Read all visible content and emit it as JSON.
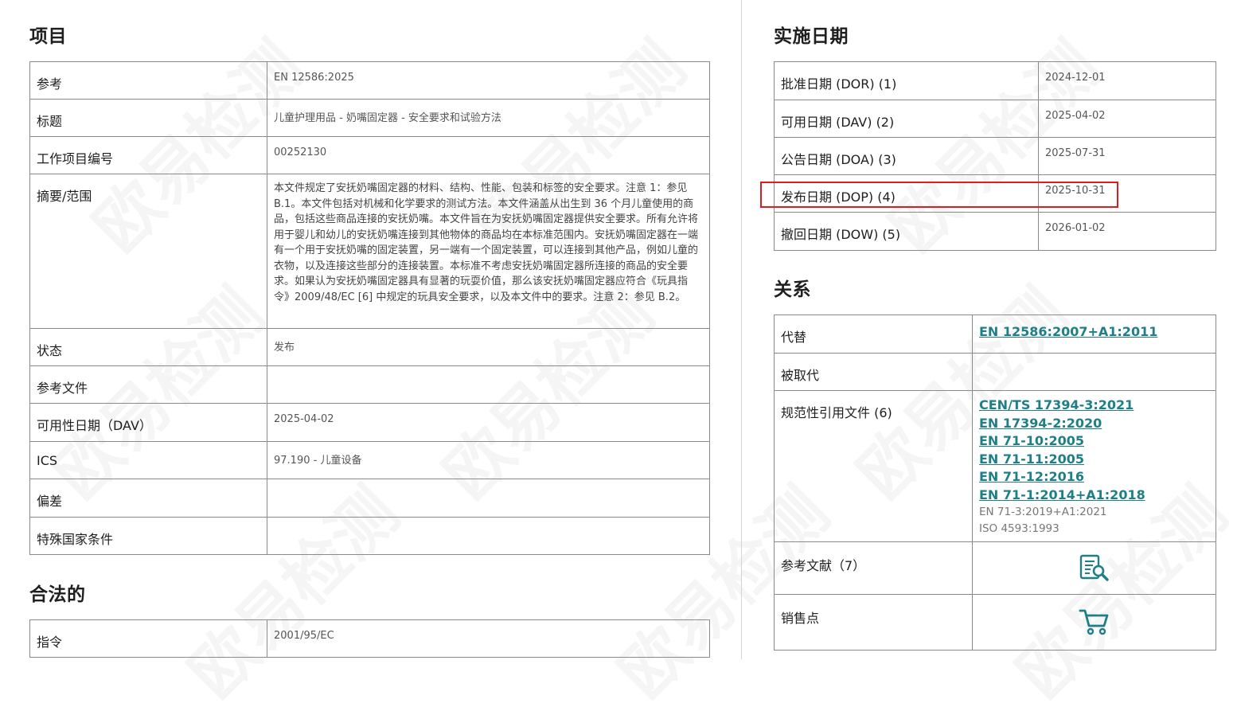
{
  "left": {
    "section1_title": "项目",
    "rows": [
      {
        "k": "参考",
        "v": "EN 12586:2025"
      },
      {
        "k": "标题",
        "v": "儿童护理用品 - 奶嘴固定器 - 安全要求和试验方法"
      },
      {
        "k": "工作项目编号",
        "v": "00252130"
      },
      {
        "k": "摘要/范围",
        "v": "本文件规定了安抚奶嘴固定器的材料、结构、性能、包装和标签的安全要求。注意 1：参见 B.1。本文件包括对机械和化学要求的测试方法。本文件涵盖从出生到 36 个月儿童使用的商品，包括这些商品连接的安抚奶嘴。本文件旨在为安抚奶嘴固定器提供安全要求。所有允许将用于婴儿和幼儿的安抚奶嘴连接到其他物体的商品均在本标准范围内。安抚奶嘴固定器在一端有一个用于安抚奶嘴的固定装置，另一端有一个固定装置，可以连接到其他产品，例如儿童的衣物，以及连接这些部分的连接装置。本标准不考虑安抚奶嘴固定器所连接的商品的安全要求。如果认为安抚奶嘴固定器具有显著的玩耍价值，那么该安抚奶嘴固定器应符合《玩具指令》2009/48/EC [6] 中规定的玩具安全要求，以及本文件中的要求。注意 2：参见 B.2。"
      },
      {
        "k": "状态",
        "v": "发布"
      },
      {
        "k": "参考文件",
        "v": ""
      },
      {
        "k": "可用性日期（DAV）",
        "v": "2025-04-02"
      },
      {
        "k": "ICS",
        "v": "97.190 - 儿童设备"
      },
      {
        "k": "偏差",
        "v": ""
      },
      {
        "k": "特殊国家条件",
        "v": ""
      }
    ],
    "section2_title": "合法的",
    "legal_rows": [
      {
        "k": "指令",
        "v": "2001/95/EC"
      }
    ]
  },
  "right": {
    "section1_title": "实施日期",
    "dates": [
      {
        "k": "批准日期 (DOR) (1)",
        "v": "2024-12-01"
      },
      {
        "k": "可用日期 (DAV) (2)",
        "v": "2025-04-02"
      },
      {
        "k": "公告日期 (DOA) (3)",
        "v": "2025-07-31"
      },
      {
        "k": "发布日期 (DOP) (4)",
        "v": "2025-10-31"
      },
      {
        "k": "撤回日期 (DOW) (5)",
        "v": "2026-01-02"
      }
    ],
    "section2_title": "关系",
    "relations": {
      "replaces_label": "代替",
      "replaces": [
        "EN 12586:2007+A1:2011"
      ],
      "replaced_by_label": "被取代",
      "normative_label": "规范性引用文件 (6)",
      "normative_links": [
        "CEN/TS 17394-3:2021",
        "EN 17394-2:2020",
        "EN 71-10:2005",
        "EN 71-11:2005",
        "EN 71-12:2016",
        "EN 71-1:2014+A1:2018"
      ],
      "normative_plain": [
        "EN 71-3:2019+A1:2021",
        "ISO 4593:1993"
      ],
      "bibliography_label": "参考文献（7）",
      "sales_label": "销售点"
    }
  },
  "watermark_text": "欧易检测",
  "colors": {
    "link": "#1f7f86",
    "highlight": "#e21c1c",
    "border": "#8a8a8a"
  },
  "icons": {
    "bibliography": "document-search-icon",
    "sales": "shopping-cart-icon"
  }
}
